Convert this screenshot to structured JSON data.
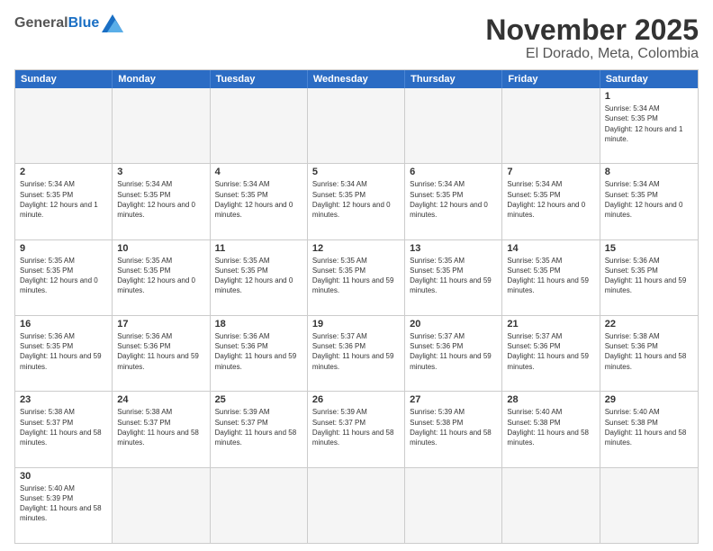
{
  "logo": {
    "general": "General",
    "blue": "Blue"
  },
  "title": "November 2025",
  "location": "El Dorado, Meta, Colombia",
  "weekdays": [
    "Sunday",
    "Monday",
    "Tuesday",
    "Wednesday",
    "Thursday",
    "Friday",
    "Saturday"
  ],
  "weeks": [
    [
      {
        "day": "",
        "empty": true
      },
      {
        "day": "",
        "empty": true
      },
      {
        "day": "",
        "empty": true
      },
      {
        "day": "",
        "empty": true
      },
      {
        "day": "",
        "empty": true
      },
      {
        "day": "",
        "empty": true
      },
      {
        "day": "1",
        "sunrise": "5:34 AM",
        "sunset": "5:35 PM",
        "daylight": "12 hours and 1 minute."
      }
    ],
    [
      {
        "day": "2",
        "sunrise": "5:34 AM",
        "sunset": "5:35 PM",
        "daylight": "12 hours and 1 minute."
      },
      {
        "day": "3",
        "sunrise": "5:34 AM",
        "sunset": "5:35 PM",
        "daylight": "12 hours and 0 minutes."
      },
      {
        "day": "4",
        "sunrise": "5:34 AM",
        "sunset": "5:35 PM",
        "daylight": "12 hours and 0 minutes."
      },
      {
        "day": "5",
        "sunrise": "5:34 AM",
        "sunset": "5:35 PM",
        "daylight": "12 hours and 0 minutes."
      },
      {
        "day": "6",
        "sunrise": "5:34 AM",
        "sunset": "5:35 PM",
        "daylight": "12 hours and 0 minutes."
      },
      {
        "day": "7",
        "sunrise": "5:34 AM",
        "sunset": "5:35 PM",
        "daylight": "12 hours and 0 minutes."
      },
      {
        "day": "8",
        "sunrise": "5:34 AM",
        "sunset": "5:35 PM",
        "daylight": "12 hours and 0 minutes."
      }
    ],
    [
      {
        "day": "9",
        "sunrise": "5:35 AM",
        "sunset": "5:35 PM",
        "daylight": "12 hours and 0 minutes."
      },
      {
        "day": "10",
        "sunrise": "5:35 AM",
        "sunset": "5:35 PM",
        "daylight": "12 hours and 0 minutes."
      },
      {
        "day": "11",
        "sunrise": "5:35 AM",
        "sunset": "5:35 PM",
        "daylight": "12 hours and 0 minutes."
      },
      {
        "day": "12",
        "sunrise": "5:35 AM",
        "sunset": "5:35 PM",
        "daylight": "11 hours and 59 minutes."
      },
      {
        "day": "13",
        "sunrise": "5:35 AM",
        "sunset": "5:35 PM",
        "daylight": "11 hours and 59 minutes."
      },
      {
        "day": "14",
        "sunrise": "5:35 AM",
        "sunset": "5:35 PM",
        "daylight": "11 hours and 59 minutes."
      },
      {
        "day": "15",
        "sunrise": "5:36 AM",
        "sunset": "5:35 PM",
        "daylight": "11 hours and 59 minutes."
      }
    ],
    [
      {
        "day": "16",
        "sunrise": "5:36 AM",
        "sunset": "5:35 PM",
        "daylight": "11 hours and 59 minutes."
      },
      {
        "day": "17",
        "sunrise": "5:36 AM",
        "sunset": "5:36 PM",
        "daylight": "11 hours and 59 minutes."
      },
      {
        "day": "18",
        "sunrise": "5:36 AM",
        "sunset": "5:36 PM",
        "daylight": "11 hours and 59 minutes."
      },
      {
        "day": "19",
        "sunrise": "5:37 AM",
        "sunset": "5:36 PM",
        "daylight": "11 hours and 59 minutes."
      },
      {
        "day": "20",
        "sunrise": "5:37 AM",
        "sunset": "5:36 PM",
        "daylight": "11 hours and 59 minutes."
      },
      {
        "day": "21",
        "sunrise": "5:37 AM",
        "sunset": "5:36 PM",
        "daylight": "11 hours and 59 minutes."
      },
      {
        "day": "22",
        "sunrise": "5:38 AM",
        "sunset": "5:36 PM",
        "daylight": "11 hours and 58 minutes."
      }
    ],
    [
      {
        "day": "23",
        "sunrise": "5:38 AM",
        "sunset": "5:37 PM",
        "daylight": "11 hours and 58 minutes."
      },
      {
        "day": "24",
        "sunrise": "5:38 AM",
        "sunset": "5:37 PM",
        "daylight": "11 hours and 58 minutes."
      },
      {
        "day": "25",
        "sunrise": "5:39 AM",
        "sunset": "5:37 PM",
        "daylight": "11 hours and 58 minutes."
      },
      {
        "day": "26",
        "sunrise": "5:39 AM",
        "sunset": "5:37 PM",
        "daylight": "11 hours and 58 minutes."
      },
      {
        "day": "27",
        "sunrise": "5:39 AM",
        "sunset": "5:38 PM",
        "daylight": "11 hours and 58 minutes."
      },
      {
        "day": "28",
        "sunrise": "5:40 AM",
        "sunset": "5:38 PM",
        "daylight": "11 hours and 58 minutes."
      },
      {
        "day": "29",
        "sunrise": "5:40 AM",
        "sunset": "5:38 PM",
        "daylight": "11 hours and 58 minutes."
      }
    ],
    [
      {
        "day": "30",
        "sunrise": "5:40 AM",
        "sunset": "5:39 PM",
        "daylight": "11 hours and 58 minutes."
      },
      {
        "day": "",
        "empty": true
      },
      {
        "day": "",
        "empty": true
      },
      {
        "day": "",
        "empty": true
      },
      {
        "day": "",
        "empty": true
      },
      {
        "day": "",
        "empty": true
      },
      {
        "day": "",
        "empty": true
      }
    ]
  ]
}
